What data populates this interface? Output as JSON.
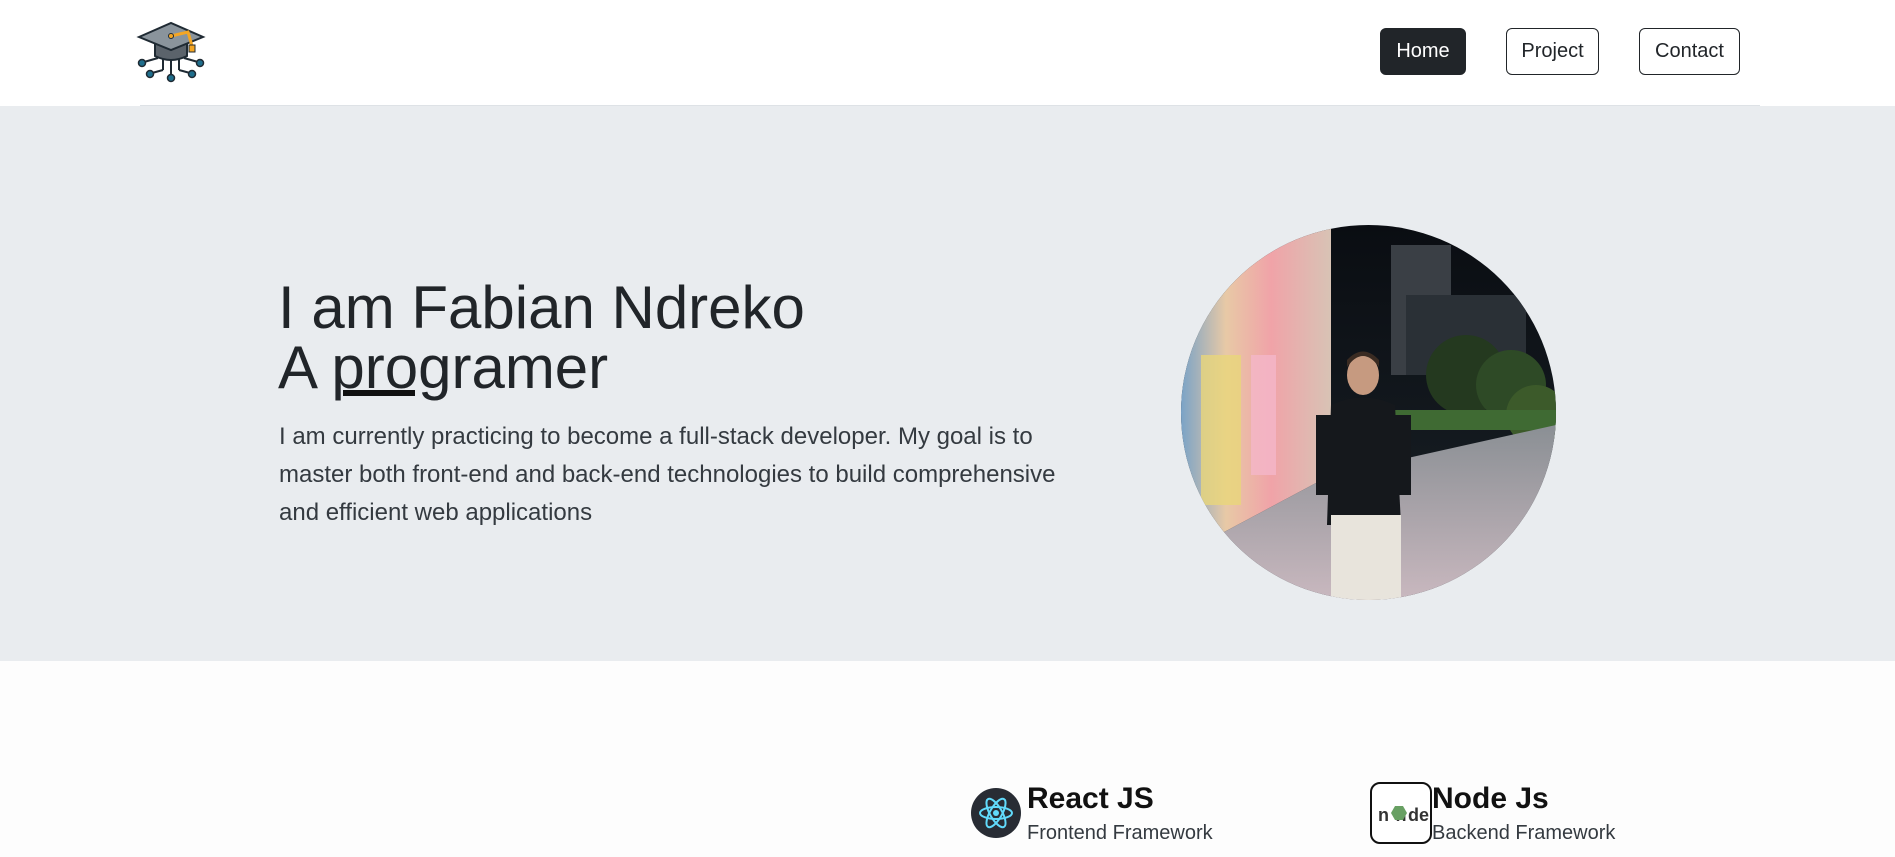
{
  "header": {
    "logo": "graduation-cap-circuit-logo",
    "nav": [
      {
        "label": "Home",
        "active": true
      },
      {
        "label": "Project",
        "active": false
      },
      {
        "label": "Contact",
        "active": false
      }
    ]
  },
  "hero": {
    "title": "I am Fabian Ndreko",
    "subtitle_prefix": "A ",
    "subtitle_typed": "pro",
    "subtitle_rest": "gramer",
    "description": "I am currently practicing to become a full-stack developer. My goal is to master both front-end and back-end technologies to build comprehensive and efficient web applications",
    "photo": "profile-photo"
  },
  "skills": [
    {
      "name": "React JS",
      "description": "Frontend Framework",
      "icon": "react-icon"
    },
    {
      "name": "Node Js",
      "description": "Backend Framework",
      "icon": "nodejs-icon"
    }
  ],
  "colors": {
    "hero_bg": "#e9ecef",
    "dark": "#212529",
    "react": "#61dafb",
    "node": "#68a063"
  }
}
